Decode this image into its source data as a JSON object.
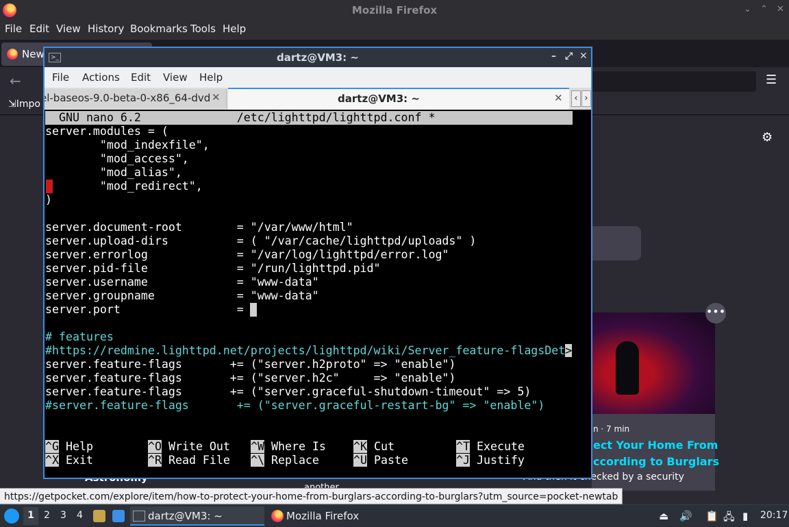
{
  "firefox": {
    "title": "Mozilla Firefox",
    "menu": [
      "File",
      "Edit",
      "View",
      "History",
      "Bookmarks",
      "Tools",
      "Help"
    ],
    "tab_label": "New",
    "import_label": "Impo",
    "card": {
      "meta": "n · 7 min",
      "title_line1": "ect Your Home From",
      "title_line2": "ccording to Burglars",
      "desc": "And then it checked by a security"
    },
    "astronomy": "Astronomy",
    "another": "another",
    "status_url": "https://getpocket.com/explore/item/how-to-protect-your-home-from-burglars-according-to-burglars?utm_source=pocket-newtab",
    "window_controls": [
      "⌄",
      "⌃",
      "✕"
    ]
  },
  "terminal": {
    "title": "dartz@VM3: ~",
    "menu": [
      "File",
      "Actions",
      "Edit",
      "View",
      "Help"
    ],
    "tabs": [
      {
        "label": "el-baseos-9.0-beta-0-x86_64-dvd",
        "close": "✕"
      },
      {
        "label": "dartz@VM3: ~",
        "close": "✕"
      }
    ],
    "window_controls": [
      "–",
      "⤢",
      "✕"
    ]
  },
  "nano": {
    "header": "  GNU nano 6.2              /etc/lighttpd/lighttpd.conf *",
    "lines": [
      "server.modules = (",
      "        \"mod_indexfile\",",
      "        \"mod_access\",",
      "        \"mod_alias\",",
      "        \"mod_redirect\",",
      ")",
      "",
      "server.document-root        = \"/var/www/html\"",
      "server.upload-dirs          = ( \"/var/cache/lighttpd/uploads\" )",
      "server.errorlog             = \"/var/log/lighttpd/error.log\"",
      "server.pid-file             = \"/run/lighttpd.pid\"",
      "server.username             = \"www-data\"",
      "server.groupname            = \"www-data\"",
      "server.port                 = ",
      "",
      "# features",
      "#https://redmine.lighttpd.net/projects/lighttpd/wiki/Server_feature-flagsDet",
      "server.feature-flags       += (\"server.h2proto\" => \"enable\")",
      "server.feature-flags       += (\"server.h2c\"     => \"enable\")",
      "server.feature-flags       += (\"server.graceful-shutdown-timeout\" => 5)",
      "#server.feature-flags       += (\"server.graceful-restart-bg\" => \"enable\")"
    ],
    "truncation_mark": ">",
    "shortcuts_row1": [
      {
        "key": "^G",
        "label": "Help"
      },
      {
        "key": "^O",
        "label": "Write Out"
      },
      {
        "key": "^W",
        "label": "Where Is"
      },
      {
        "key": "^K",
        "label": "Cut"
      },
      {
        "key": "^T",
        "label": "Execute"
      }
    ],
    "shortcuts_row2": [
      {
        "key": "^X",
        "label": "Exit"
      },
      {
        "key": "^R",
        "label": "Read File"
      },
      {
        "key": "^\\",
        "label": "Replace"
      },
      {
        "key": "^U",
        "label": "Paste"
      },
      {
        "key": "^J",
        "label": "Justify"
      }
    ]
  },
  "taskbar": {
    "workspaces": [
      "1",
      "2",
      "3",
      "4"
    ],
    "tasks": [
      {
        "label": "dartz@VM3: ~"
      },
      {
        "label": "Mozilla Firefox"
      }
    ],
    "clock": "20:17"
  }
}
